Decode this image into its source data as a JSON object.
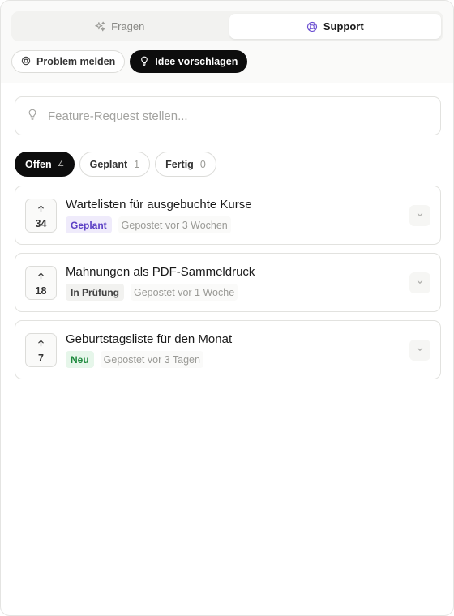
{
  "tabs": [
    {
      "label": "Fragen",
      "icon": "sparkle-icon",
      "active": false
    },
    {
      "label": "Support",
      "icon": "lifebuoy-icon",
      "active": true
    }
  ],
  "actions": [
    {
      "label": "Problem melden",
      "icon": "lifebuoy-icon",
      "active": false
    },
    {
      "label": "Idee vorschlagen",
      "icon": "lightbulb-icon",
      "active": true
    }
  ],
  "search": {
    "placeholder": "Feature-Request stellen...",
    "value": "",
    "icon": "lightbulb-icon"
  },
  "filters": [
    {
      "label": "Offen",
      "count": "4",
      "active": true
    },
    {
      "label": "Geplant",
      "count": "1",
      "active": false
    },
    {
      "label": "Fertig",
      "count": "0",
      "active": false
    }
  ],
  "requests": [
    {
      "votes": "34",
      "title": "Wartelisten für ausgebuchte Kurse",
      "status": "Geplant",
      "posted": "Gepostet vor 3 Wochen",
      "status_color": "#5b3fc4",
      "status_bg": "#efebfb"
    },
    {
      "votes": "18",
      "title": "Mahnungen als PDF-Sammeldruck",
      "status": "In Prüfung",
      "posted": "Gepostet vor 1 Woche",
      "status_color": "#444444",
      "status_bg": "#f2f2f0"
    },
    {
      "votes": "7",
      "title": "Geburtstagsliste für den Monat",
      "status": "Neu",
      "posted": "Gepostet vor 3 Tagen",
      "status_color": "#1f8a3e",
      "status_bg": "#e6f6ea"
    }
  ],
  "colors": {
    "accent_dark": "#0d0d0d",
    "border": "#e2e2df",
    "muted": "#9a9a96"
  }
}
